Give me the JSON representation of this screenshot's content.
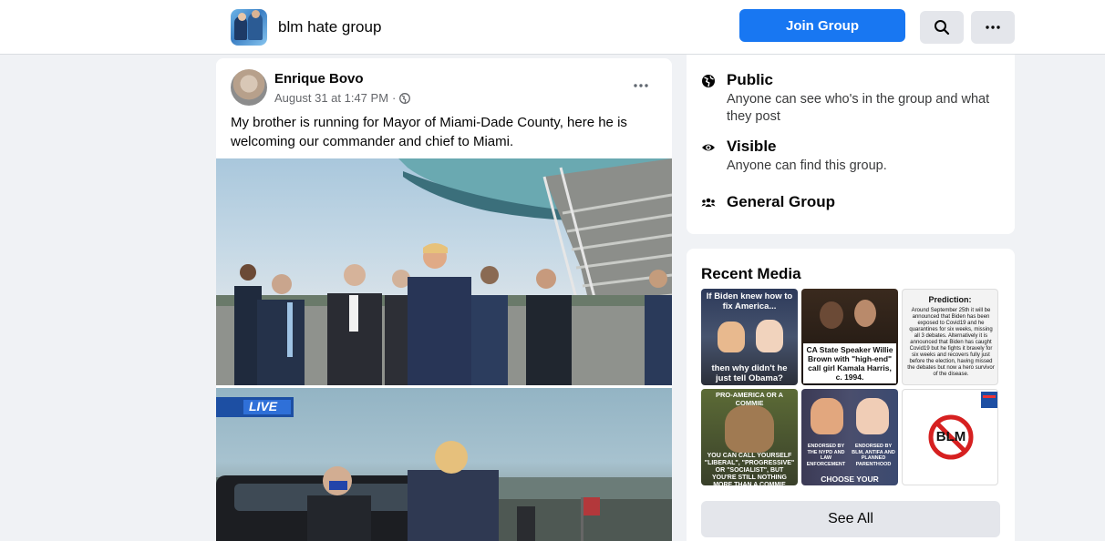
{
  "header": {
    "group_name": "blm hate group",
    "join_label": "Join Group"
  },
  "post": {
    "author": "Enrique Bovo",
    "date": "August 31 at 1:47 PM",
    "separator": "·",
    "text": "My brother is running for Mayor of Miami-Dade County, here he is welcoming our commander and chief to Miami.",
    "photo2_overlay": "LIVE"
  },
  "about": {
    "items": [
      {
        "title": "Public",
        "desc": "Anyone can see who's in the group and what they post",
        "icon": "globe-icon"
      },
      {
        "title": "Visible",
        "desc": "Anyone can find this group.",
        "icon": "eye-icon"
      },
      {
        "title": "General Group",
        "desc": "",
        "icon": "people-icon"
      }
    ]
  },
  "media": {
    "title": "Recent Media",
    "see_all": "See All",
    "thumbs": [
      {
        "caption_top": "If Biden knew how to fix America...",
        "caption_bottom": "then why didn't he just tell Obama?"
      },
      {
        "caption_bottom": "CA State Speaker Willie Brown with \"high-end\" call girl Kamala Harris, c. 1994."
      },
      {
        "caption_top": "Prediction:",
        "caption_body": "Around September 25th it will be announced that Biden has been exposed to Covid19 and he quarantines for six weeks, missing all 3 debates. Alternatively it is announced that Biden has caught Covid19 but he fights it bravely for six weeks and recovers fully just before the election, having missed the debates but now a hero survivor of the disease."
      },
      {
        "caption_top": "PRO-AMERICA OR A COMMIE",
        "caption_bottom": "YOU CAN CALL YOURSELF \"LIBERAL\", \"PROGRESSIVE\" OR \"SOCIALIST\", BUT YOU'RE STILL NOTHING MORE THAN A COMMIE"
      },
      {
        "caption_left": "ENDORSED BY THE NYPD AND LAW ENFORCEMENT",
        "caption_right": "ENDORSED BY BLM, ANTIFA AND PLANNED PARENTHOOD",
        "caption_bottom": "CHOOSE YOUR PRESIDENT!"
      },
      {
        "symbol_text": "BLM"
      }
    ]
  },
  "colors": {
    "accent": "#1877f2",
    "bg": "#f0f2f5"
  }
}
